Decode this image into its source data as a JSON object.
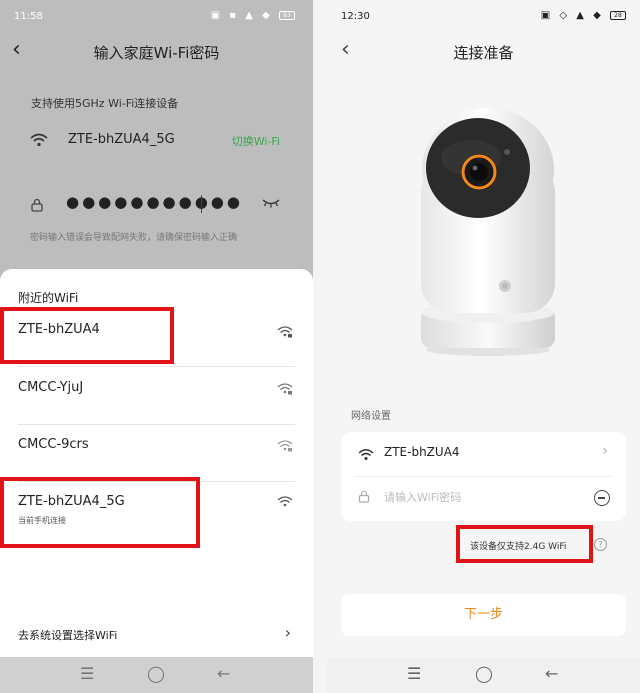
{
  "left": {
    "status": {
      "time": "11:58",
      "icons": "▣  ▪ ▲ ◆",
      "battery": "93"
    },
    "title": "输入家庭Wi-Fi密码",
    "support_text": "支持使用5GHz Wi-Fi连接设备",
    "current_ssid": "ZTE-bhZUA4_5G",
    "switch_wifi": "切换Wi-Fi",
    "password_mask": "●●●●●●●●●●●",
    "hint": "密码输入错误会导致配网失败，请确保密码输入正确",
    "sheet": {
      "title": "附近的WiFi",
      "networks": [
        {
          "name": "ZTE-bhZUA4",
          "sub": ""
        },
        {
          "name": "CMCC-YjuJ",
          "sub": ""
        },
        {
          "name": "CMCC-9crs",
          "sub": ""
        },
        {
          "name": "ZTE-bhZUA4_5G",
          "sub": "当前手机连接"
        }
      ],
      "system_settings": "去系统设置选择WiFi",
      "chevron": "›"
    },
    "nav": {
      "menu": "☰",
      "home": "◯",
      "back": "←"
    }
  },
  "right": {
    "status": {
      "time": "12:30",
      "icons": "▣  ◇ ▲ ◆",
      "battery": "28"
    },
    "title": "连接准备",
    "section_label": "网络设置",
    "ssid": "ZTE-bhZUA4",
    "chevron": "›",
    "password_placeholder": "请输入WiFi密码",
    "note": "该设备仅支持2.4G WiFi",
    "help": "?",
    "next_button": "下一步",
    "nav": {
      "menu": "☰",
      "home": "◯",
      "back": "←"
    }
  },
  "colors": {
    "highlight_red": "#e11218",
    "accent_orange": "#f28a1a",
    "switch_green": "#3aa64a"
  }
}
